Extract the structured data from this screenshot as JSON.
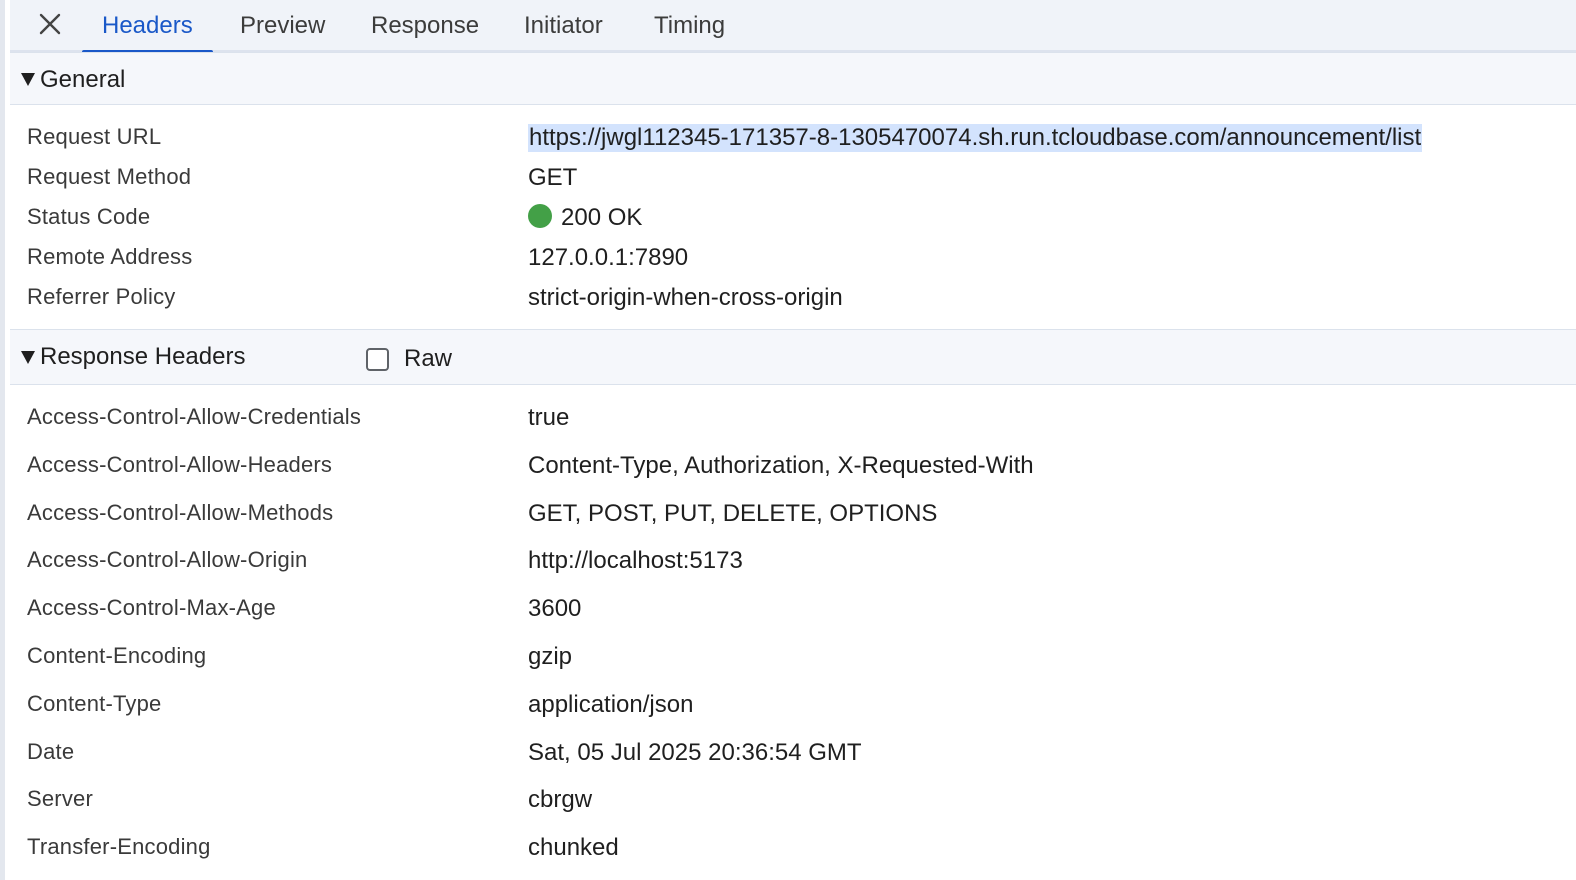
{
  "tabs": [
    {
      "label": "Headers",
      "active": true
    },
    {
      "label": "Preview",
      "active": false
    },
    {
      "label": "Response",
      "active": false
    },
    {
      "label": "Initiator",
      "active": false
    },
    {
      "label": "Timing",
      "active": false
    }
  ],
  "general": {
    "title": "General",
    "rows": [
      {
        "key": "Request URL",
        "value": "https://jwgl112345-171357-8-1305470074.sh.run.tcloudbase.com/announcement/list"
      },
      {
        "key": "Request Method",
        "value": "GET"
      },
      {
        "key": "Status Code",
        "value": "200 OK"
      },
      {
        "key": "Remote Address",
        "value": "127.0.0.1:7890"
      },
      {
        "key": "Referrer Policy",
        "value": "strict-origin-when-cross-origin"
      }
    ]
  },
  "response_headers": {
    "title": "Response Headers",
    "raw_label": "Raw",
    "raw_checked": false,
    "rows": [
      {
        "key": "Access-Control-Allow-Credentials",
        "value": "true"
      },
      {
        "key": "Access-Control-Allow-Headers",
        "value": "Content-Type, Authorization, X-Requested-With"
      },
      {
        "key": "Access-Control-Allow-Methods",
        "value": "GET, POST, PUT, DELETE, OPTIONS"
      },
      {
        "key": "Access-Control-Allow-Origin",
        "value": "http://localhost:5173"
      },
      {
        "key": "Access-Control-Max-Age",
        "value": "3600"
      },
      {
        "key": "Content-Encoding",
        "value": "gzip"
      },
      {
        "key": "Content-Type",
        "value": "application/json"
      },
      {
        "key": "Date",
        "value": "Sat, 05 Jul 2025 20:36:54 GMT"
      },
      {
        "key": "Server",
        "value": "cbrgw"
      },
      {
        "key": "Transfer-Encoding",
        "value": "chunked"
      }
    ]
  },
  "colors": {
    "accent": "#1a58c8",
    "status_ok": "#43a047",
    "selection": "#d3e3fd"
  },
  "icons": {
    "close": "close-icon",
    "collapse": "triangle-down-icon"
  }
}
